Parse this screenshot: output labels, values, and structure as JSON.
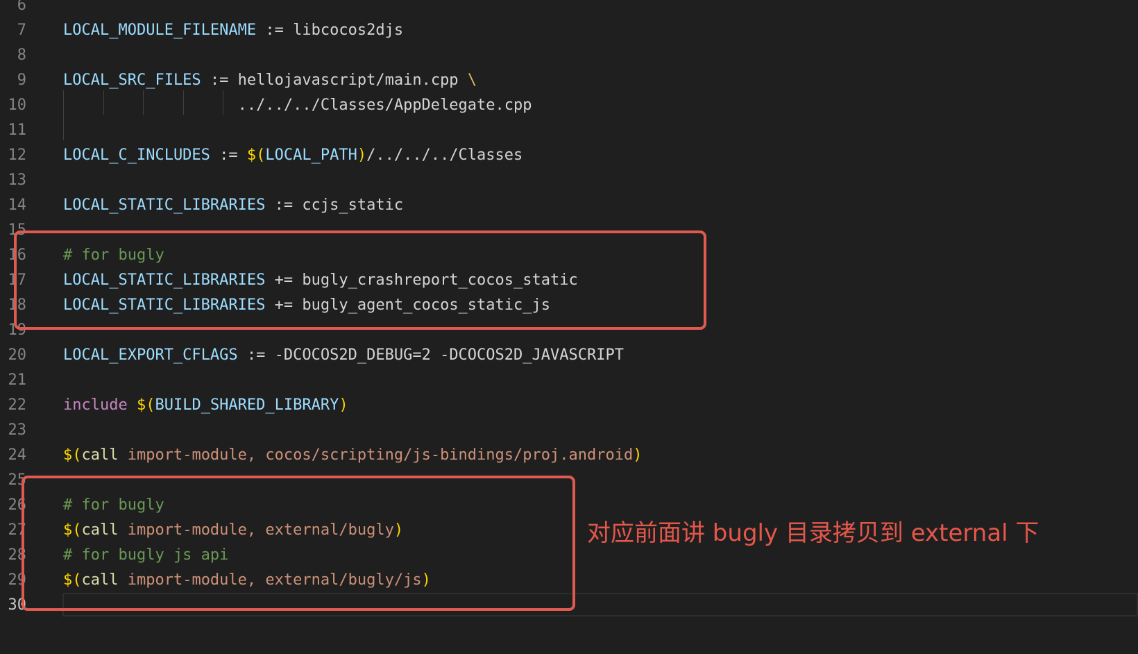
{
  "editor": {
    "lines": [
      {
        "num": "6",
        "tokens": []
      },
      {
        "num": "7",
        "tokens": [
          {
            "cls": "tok-var",
            "text": "LOCAL_MODULE_FILENAME"
          },
          {
            "cls": "tok-op",
            "text": " := "
          },
          {
            "cls": "tok-plain",
            "text": "libcocos2djs"
          }
        ]
      },
      {
        "num": "8",
        "tokens": []
      },
      {
        "num": "9",
        "tokens": [
          {
            "cls": "tok-var",
            "text": "LOCAL_SRC_FILES"
          },
          {
            "cls": "tok-op",
            "text": " := "
          },
          {
            "cls": "tok-plain",
            "text": "hellojavascript/main.cpp "
          },
          {
            "cls": "tok-cont",
            "text": "\\"
          }
        ]
      },
      {
        "num": "10",
        "tokens": [
          {
            "cls": "tok-plain",
            "text": "                   ../../../Classes/AppDelegate.cpp"
          }
        ]
      },
      {
        "num": "11",
        "tokens": []
      },
      {
        "num": "12",
        "tokens": [
          {
            "cls": "tok-var",
            "text": "LOCAL_C_INCLUDES"
          },
          {
            "cls": "tok-op",
            "text": " := "
          },
          {
            "cls": "tok-dollar",
            "text": "$("
          },
          {
            "cls": "tok-var",
            "text": "LOCAL_PATH"
          },
          {
            "cls": "tok-paren",
            "text": ")"
          },
          {
            "cls": "tok-plain",
            "text": "/../../../Classes"
          }
        ]
      },
      {
        "num": "13",
        "tokens": []
      },
      {
        "num": "14",
        "tokens": [
          {
            "cls": "tok-var",
            "text": "LOCAL_STATIC_LIBRARIES"
          },
          {
            "cls": "tok-op",
            "text": " := "
          },
          {
            "cls": "tok-plain",
            "text": "ccjs_static"
          }
        ]
      },
      {
        "num": "15",
        "tokens": []
      },
      {
        "num": "16",
        "tokens": [
          {
            "cls": "tok-comment",
            "text": "# for bugly"
          }
        ]
      },
      {
        "num": "17",
        "tokens": [
          {
            "cls": "tok-var",
            "text": "LOCAL_STATIC_LIBRARIES"
          },
          {
            "cls": "tok-op",
            "text": " += "
          },
          {
            "cls": "tok-plain",
            "text": "bugly_crashreport_cocos_static"
          }
        ]
      },
      {
        "num": "18",
        "tokens": [
          {
            "cls": "tok-var",
            "text": "LOCAL_STATIC_LIBRARIES"
          },
          {
            "cls": "tok-op",
            "text": " += "
          },
          {
            "cls": "tok-plain",
            "text": "bugly_agent_cocos_static_js"
          }
        ]
      },
      {
        "num": "19",
        "tokens": []
      },
      {
        "num": "20",
        "tokens": [
          {
            "cls": "tok-var",
            "text": "LOCAL_EXPORT_CFLAGS"
          },
          {
            "cls": "tok-op",
            "text": " := "
          },
          {
            "cls": "tok-plain",
            "text": "-DCOCOS2D_DEBUG=2 -DCOCOS2D_JAVASCRIPT"
          }
        ]
      },
      {
        "num": "21",
        "tokens": []
      },
      {
        "num": "22",
        "tokens": [
          {
            "cls": "tok-kw",
            "text": "include"
          },
          {
            "cls": "tok-plain",
            "text": " "
          },
          {
            "cls": "tok-dollar",
            "text": "$("
          },
          {
            "cls": "tok-var",
            "text": "BUILD_SHARED_LIBRARY"
          },
          {
            "cls": "tok-paren",
            "text": ")"
          }
        ]
      },
      {
        "num": "23",
        "tokens": []
      },
      {
        "num": "24",
        "tokens": [
          {
            "cls": "tok-dollar",
            "text": "$("
          },
          {
            "cls": "tok-fn",
            "text": "call"
          },
          {
            "cls": "tok-arg",
            "text": " import-module, cocos/scripting/js-bindings/proj.android"
          },
          {
            "cls": "tok-paren",
            "text": ")"
          }
        ]
      },
      {
        "num": "25",
        "tokens": []
      },
      {
        "num": "26",
        "tokens": [
          {
            "cls": "tok-comment",
            "text": "# for bugly"
          }
        ]
      },
      {
        "num": "27",
        "tokens": [
          {
            "cls": "tok-dollar",
            "text": "$("
          },
          {
            "cls": "tok-fn",
            "text": "call"
          },
          {
            "cls": "tok-arg",
            "text": " import-module, external/bugly"
          },
          {
            "cls": "tok-paren",
            "text": ")"
          }
        ]
      },
      {
        "num": "28",
        "tokens": [
          {
            "cls": "tok-comment",
            "text": "# for bugly js api"
          }
        ]
      },
      {
        "num": "29",
        "tokens": [
          {
            "cls": "tok-dollar",
            "text": "$("
          },
          {
            "cls": "tok-fn",
            "text": "call"
          },
          {
            "cls": "tok-arg",
            "text": " import-module, external/bugly/js"
          },
          {
            "cls": "tok-paren",
            "text": ")"
          }
        ]
      },
      {
        "num": "30",
        "tokens": []
      }
    ]
  },
  "annotation": {
    "text": "对应前面讲 bugly 目录拷贝到 external 下"
  },
  "colors": {
    "background": "#1f1f1f",
    "highlight": "#e05a4f",
    "line_number": "#858585",
    "variable": "#9cdcfe",
    "comment": "#6a9955",
    "keyword": "#c586c0",
    "string_arg": "#ce9178",
    "bracket": "#ffd700"
  }
}
